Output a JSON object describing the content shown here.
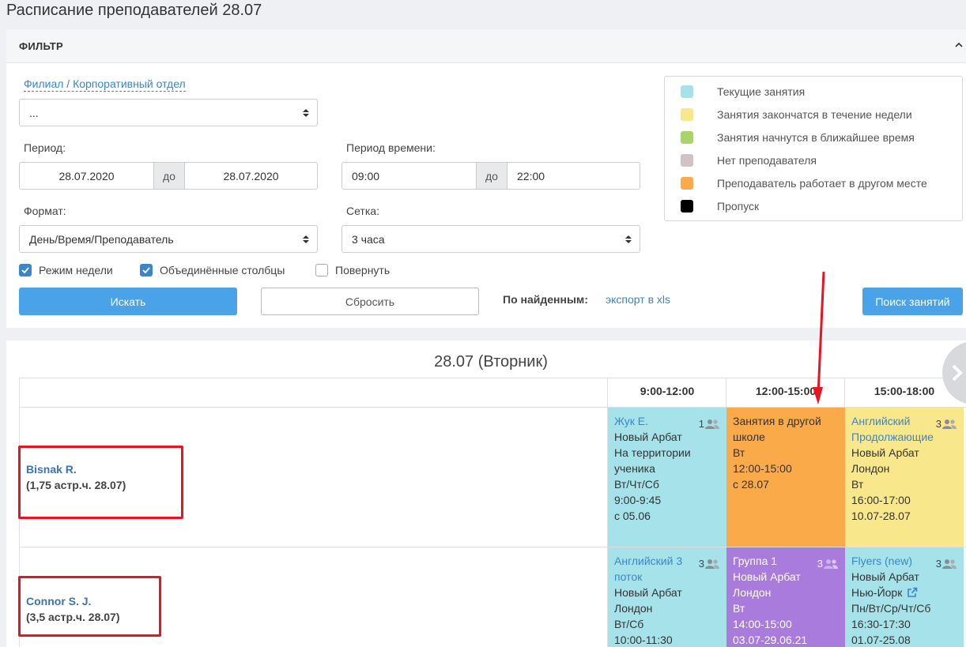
{
  "page": {
    "title": "Расписание преподавателей 28.07"
  },
  "filter": {
    "header": "ФИЛЬТР",
    "branch_label": "Филиал / Корпоративный отдел",
    "branch_value": "...",
    "period_label": "Период:",
    "period_from": "28.07.2020",
    "period_sep": "до",
    "period_to": "28.07.2020",
    "time_label": "Период времени:",
    "time_from": "09:00",
    "time_sep": "до",
    "time_to": "22:00",
    "format_label": "Формат:",
    "format_value": "День/Время/Преподаватель",
    "grid_label": "Сетка:",
    "grid_value": "3 часа",
    "checkboxes": [
      {
        "label": "Режим недели",
        "checked": true
      },
      {
        "label": "Объединённые столбцы",
        "checked": true
      },
      {
        "label": "Повернуть",
        "checked": false
      }
    ],
    "search_button": "Искать",
    "reset_button": "Сбросить",
    "found_label": "По найденным:",
    "export_link": "экспорт в xls",
    "lesson_search_button": "Поиск занятий"
  },
  "legend": [
    {
      "label": "Текущие занятия",
      "color": "#a6e2e9"
    },
    {
      "label": "Занятия закончатся в течение недели",
      "color": "#f9e88b"
    },
    {
      "label": "Занятия начнутся в ближайшее время",
      "color": "#a8d468"
    },
    {
      "label": "Нет преподавателя",
      "color": "#d3c2c4"
    },
    {
      "label": "Преподаватель работает в другом месте",
      "color": "#fbaa4a"
    },
    {
      "label": "Пропуск",
      "color": "#000000"
    }
  ],
  "schedule": {
    "day_title": "28.07 (Вторник)",
    "columns": [
      "9:00-12:00",
      "12:00-15:00",
      "15:00-18:00"
    ],
    "teachers": [
      {
        "name": "Bisnak R.",
        "hours": "(1,75 астр.ч. 28.07)",
        "cells": [
          {
            "color": "cyan",
            "title": "Жук Е.",
            "count": "1",
            "lines": [
              "Новый Арбат",
              "На территории",
              "ученика",
              "Вт/Чт/Сб",
              "9:00-9:45",
              "с 05.06"
            ]
          },
          {
            "color": "orange",
            "title": "",
            "count": "",
            "lines": [
              "Занятия в другой",
              "школе",
              "Вт",
              "12:00-15:00",
              "с 28.07"
            ]
          },
          {
            "color": "yellow",
            "title": "Английский Продолжающие",
            "count": "3",
            "lines": [
              "Новый Арбат",
              "Лондон",
              "Вт",
              "16:00-17:00",
              "10.07-28.07"
            ]
          }
        ]
      },
      {
        "name": "Connor S. J.",
        "hours": "(3,5 астр.ч. 28.07)",
        "cells": [
          {
            "color": "cyan",
            "title": "Английский 3 поток",
            "count": "3",
            "lines": [
              "Новый Арбат",
              "Лондон",
              "Вт/Сб",
              "10:00-11:30"
            ]
          },
          {
            "color": "purple",
            "title": "Группа 1",
            "count": "3",
            "lines": [
              "Новый Арбат",
              "Лондон",
              "Вт",
              "14:00-15:00",
              "03.07-29.06.21"
            ]
          },
          {
            "color": "cyan",
            "title": "Flyers (new)",
            "count": "3",
            "lines": [
              "Новый Арбат",
              "Нью-Йорк",
              "Пн/Вт/Ср/Чт/Сб",
              "16:30-17:30",
              "01.07-25.08"
            ]
          }
        ]
      }
    ]
  }
}
